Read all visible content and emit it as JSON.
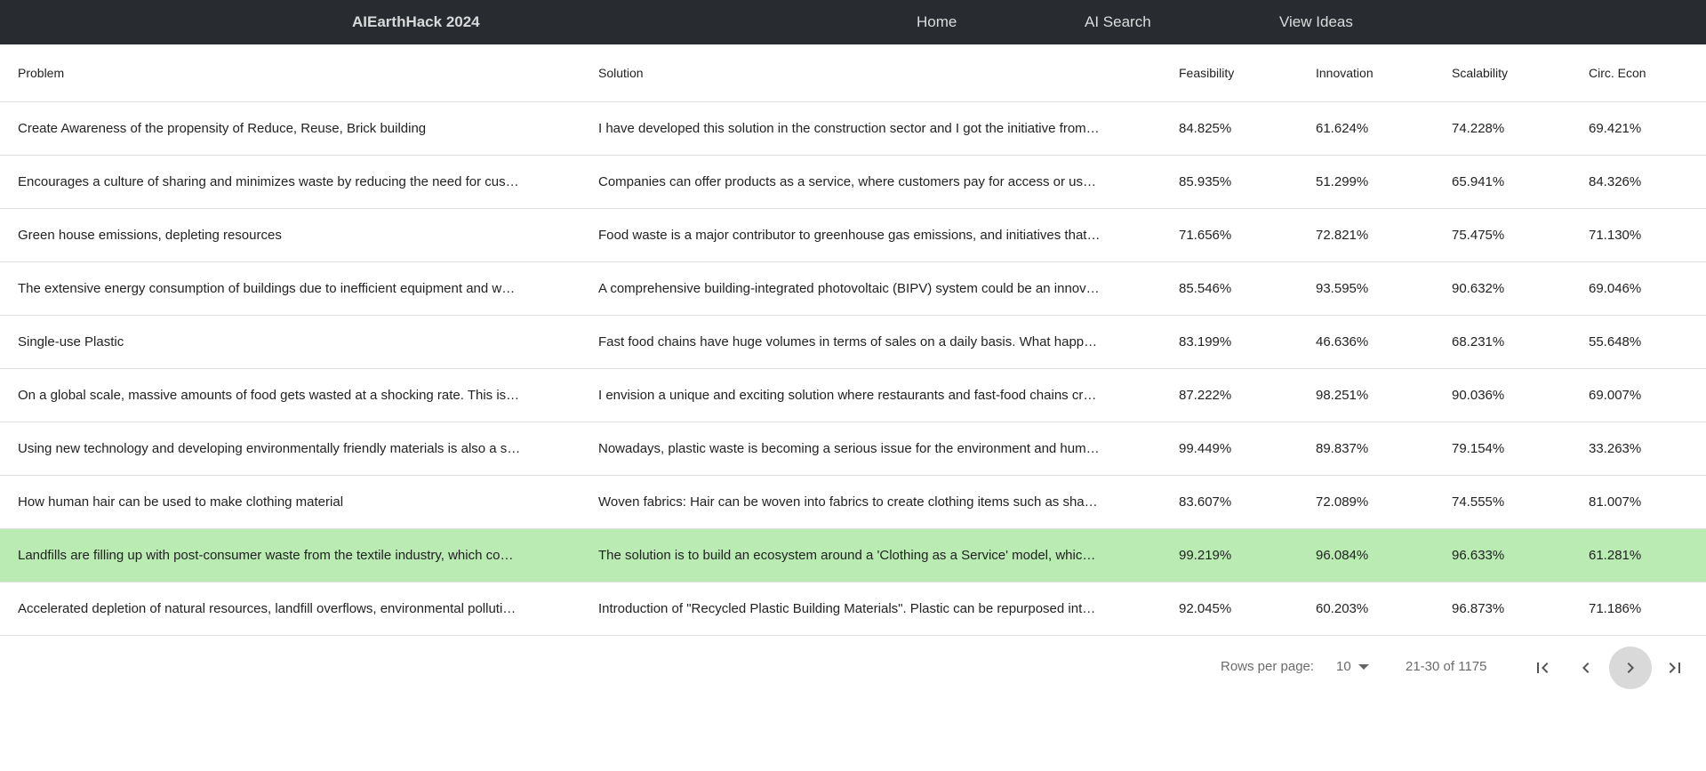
{
  "navbar": {
    "brand": "AIEarthHack 2024",
    "links": [
      "Home",
      "AI Search",
      "View Ideas"
    ]
  },
  "table": {
    "columns": [
      "Problem",
      "Solution",
      "Feasibility",
      "Innovation",
      "Scalability",
      "Circ. Econ"
    ],
    "rows": [
      {
        "problem": "Create Awareness of the propensity of Reduce, Reuse, Brick building",
        "solution": "I have developed this solution in the construction sector and I got the initiative from…",
        "feasibility": "84.825%",
        "innovation": "61.624%",
        "scalability": "74.228%",
        "circ_econ": "69.421%",
        "selected": false
      },
      {
        "problem": "Encourages a culture of sharing and minimizes waste by reducing the need for cus…",
        "solution": "Companies can offer products as a service, where customers pay for access or us…",
        "feasibility": "85.935%",
        "innovation": "51.299%",
        "scalability": "65.941%",
        "circ_econ": "84.326%",
        "selected": false
      },
      {
        "problem": "Green house emissions, depleting resources",
        "solution": "Food waste is a major contributor to greenhouse gas emissions, and initiatives that…",
        "feasibility": "71.656%",
        "innovation": "72.821%",
        "scalability": "75.475%",
        "circ_econ": "71.130%",
        "selected": false
      },
      {
        "problem": "The extensive energy consumption of buildings due to inefficient equipment and w…",
        "solution": "A comprehensive building-integrated photovoltaic (BIPV) system could be an innov…",
        "feasibility": "85.546%",
        "innovation": "93.595%",
        "scalability": "90.632%",
        "circ_econ": "69.046%",
        "selected": false
      },
      {
        "problem": "Single-use Plastic",
        "solution": "Fast food chains have huge volumes in terms of sales on a daily basis. What happ…",
        "feasibility": "83.199%",
        "innovation": "46.636%",
        "scalability": "68.231%",
        "circ_econ": "55.648%",
        "selected": false
      },
      {
        "problem": "On a global scale, massive amounts of food gets wasted at a shocking rate. This is…",
        "solution": "I envision a unique and exciting solution where restaurants and fast-food chains cr…",
        "feasibility": "87.222%",
        "innovation": "98.251%",
        "scalability": "90.036%",
        "circ_econ": "69.007%",
        "selected": false
      },
      {
        "problem": "Using new technology and developing environmentally friendly materials is also a s…",
        "solution": "Nowadays, plastic waste is becoming a serious issue for the environment and hum…",
        "feasibility": "99.449%",
        "innovation": "89.837%",
        "scalability": "79.154%",
        "circ_econ": "33.263%",
        "selected": false
      },
      {
        "problem": "How human hair can be used to make clothing material",
        "solution": "Woven fabrics: Hair can be woven into fabrics to create clothing items such as sha…",
        "feasibility": "83.607%",
        "innovation": "72.089%",
        "scalability": "74.555%",
        "circ_econ": "81.007%",
        "selected": false
      },
      {
        "problem": "Landfills are filling up with post-consumer waste from the textile industry, which co…",
        "solution": "The solution is to build an ecosystem around a 'Clothing as a Service' model, whic…",
        "feasibility": "99.219%",
        "innovation": "96.084%",
        "scalability": "96.633%",
        "circ_econ": "61.281%",
        "selected": true
      },
      {
        "problem": "Accelerated depletion of natural resources, landfill overflows, environmental polluti…",
        "solution": "Introduction of \"Recycled Plastic Building Materials\". Plastic can be repurposed int…",
        "feasibility": "92.045%",
        "innovation": "60.203%",
        "scalability": "96.873%",
        "circ_econ": "71.186%",
        "selected": false
      }
    ]
  },
  "pagination": {
    "rows_per_page_label": "Rows per page:",
    "rows_per_page_value": "10",
    "range_text": "21-30 of 1175",
    "icons": {
      "first": "first-page-icon",
      "prev": "chevron-left-icon",
      "next": "chevron-right-icon",
      "last": "last-page-icon"
    }
  },
  "colors": {
    "navbar_bg": "#282c31",
    "selected_row": "#b9ebb3",
    "active_button": "#d9d9d9"
  }
}
